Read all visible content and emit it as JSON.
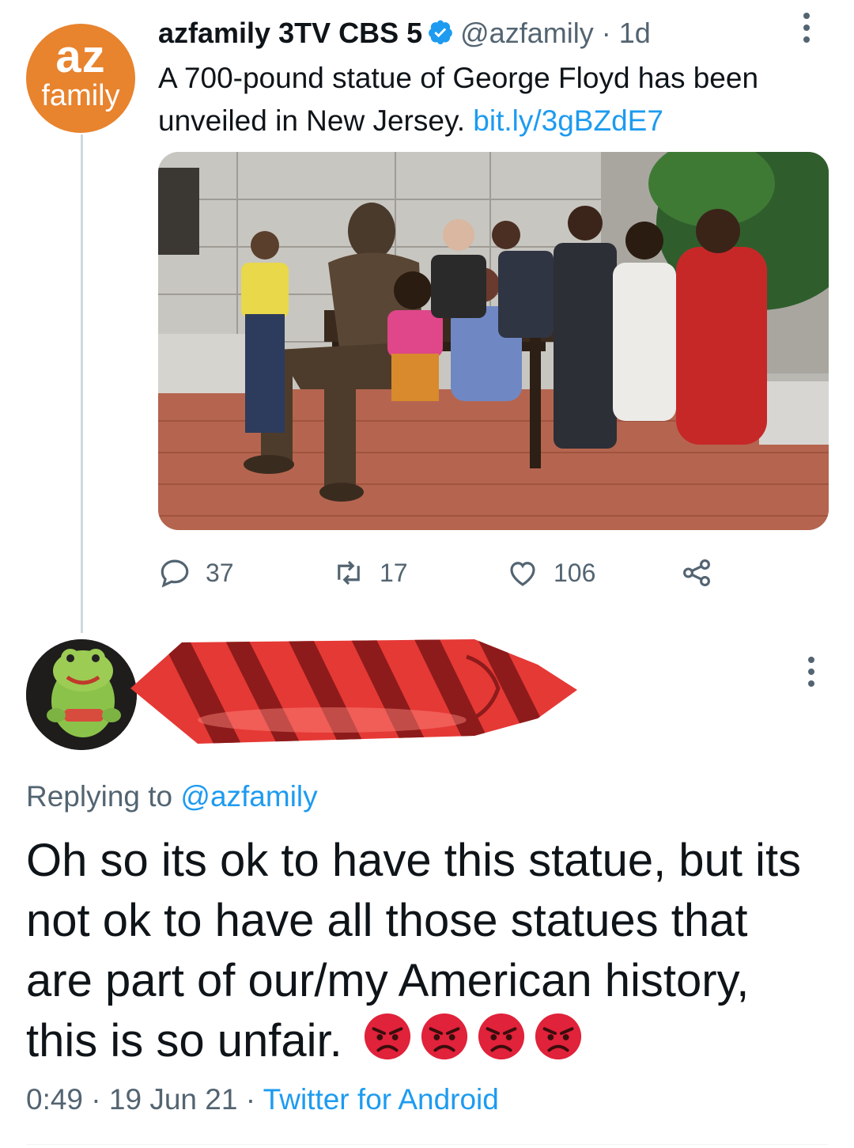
{
  "tweet": {
    "avatar": {
      "line1": "az",
      "line2": "family",
      "bg_color": "#e8832e"
    },
    "author_name": "azfamily 3TV CBS 5",
    "verified_icon": "verified-badge-icon",
    "handle": "@azfamily",
    "separator": "·",
    "time": "1d",
    "text": "A 700-pound statue of George Floyd has been unveiled in New Jersey.",
    "link": "bit.ly/3gBZdE7",
    "image_icon": "statue-photo",
    "actions": {
      "replies": {
        "icon": "reply-icon",
        "count": "37"
      },
      "retweets": {
        "icon": "retweet-icon",
        "count": "17"
      },
      "likes": {
        "icon": "heart-icon",
        "count": "106"
      },
      "share": {
        "icon": "share-icon"
      }
    }
  },
  "reply": {
    "avatar_icon": "frog-plush-avatar",
    "redaction_icon": "red-tie-redaction",
    "replying_prefix": "Replying to",
    "replying_handle": "@azfamily",
    "text": "Oh so its ok to have this statue, but its not ok to have all those statues that are part of our/my American history, this is so unfair.",
    "emoji_icon": "angry-face-icon",
    "emoji_count": 4,
    "time": "0:49",
    "sep1": "·",
    "date": "19 Jun 21",
    "sep2": "·",
    "source": "Twitter for Android"
  },
  "colors": {
    "accent": "#1d9bf0",
    "secondary_text": "#536471",
    "primary_text": "#0f1419",
    "angry_red": "#e0223a"
  }
}
